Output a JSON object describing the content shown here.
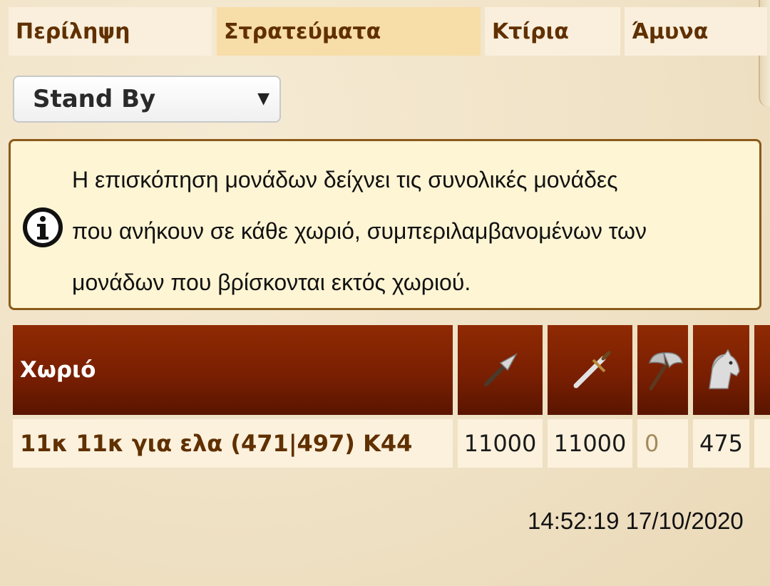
{
  "tabs": [
    {
      "label": "Περίληψη",
      "active": false
    },
    {
      "label": "Στρατεύματα",
      "active": true
    },
    {
      "label": "Κτίρια",
      "active": false
    },
    {
      "label": "Άμυνα",
      "active": false
    }
  ],
  "filter": {
    "selected": "Stand By"
  },
  "info": {
    "lines": [
      "Η επισκόπηση μονάδων δείχνει τις συνολικές μονάδες",
      "που ανήκουν σε κάθε χωριό, συμπεριλαμβανομένων των",
      "μονάδων που βρίσκονται εκτός χωριού."
    ]
  },
  "table": {
    "header_village": "Χωριό",
    "unit_icons": [
      "spear-icon",
      "sword-icon",
      "axe-icon",
      "horse-icon"
    ],
    "rows": [
      {
        "village": "11κ 11κ για ελα (471|497) Κ44",
        "units": [
          "11000",
          "11000",
          "0",
          "475"
        ]
      }
    ]
  },
  "timestamp": "14:52:19 17/10/2020",
  "colors": {
    "header_bg": "#7a1f02",
    "tab_active": "#f7dda8",
    "link_brown": "#603000",
    "zero_value": "#a38a5e"
  }
}
